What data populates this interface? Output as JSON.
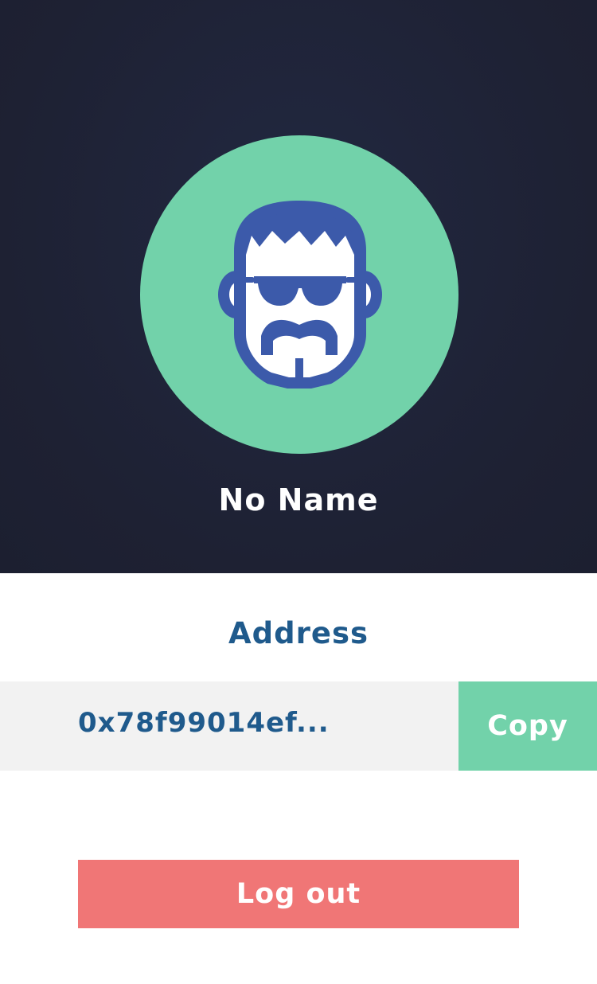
{
  "profile": {
    "avatar_icon": "bearded-sunglasses-face-icon",
    "name": "No Name"
  },
  "address": {
    "title": "Address",
    "value": "0x78f99014ef...",
    "copy_label": "Copy"
  },
  "actions": {
    "logout_label": "Log out"
  },
  "colors": {
    "header_background": "#1e2133",
    "accent_green": "#72d2aa",
    "avatar_blue": "#3c5aaa",
    "title_blue": "#1f5a8c",
    "address_background": "#f2f2f2",
    "logout_red": "#f07676"
  }
}
